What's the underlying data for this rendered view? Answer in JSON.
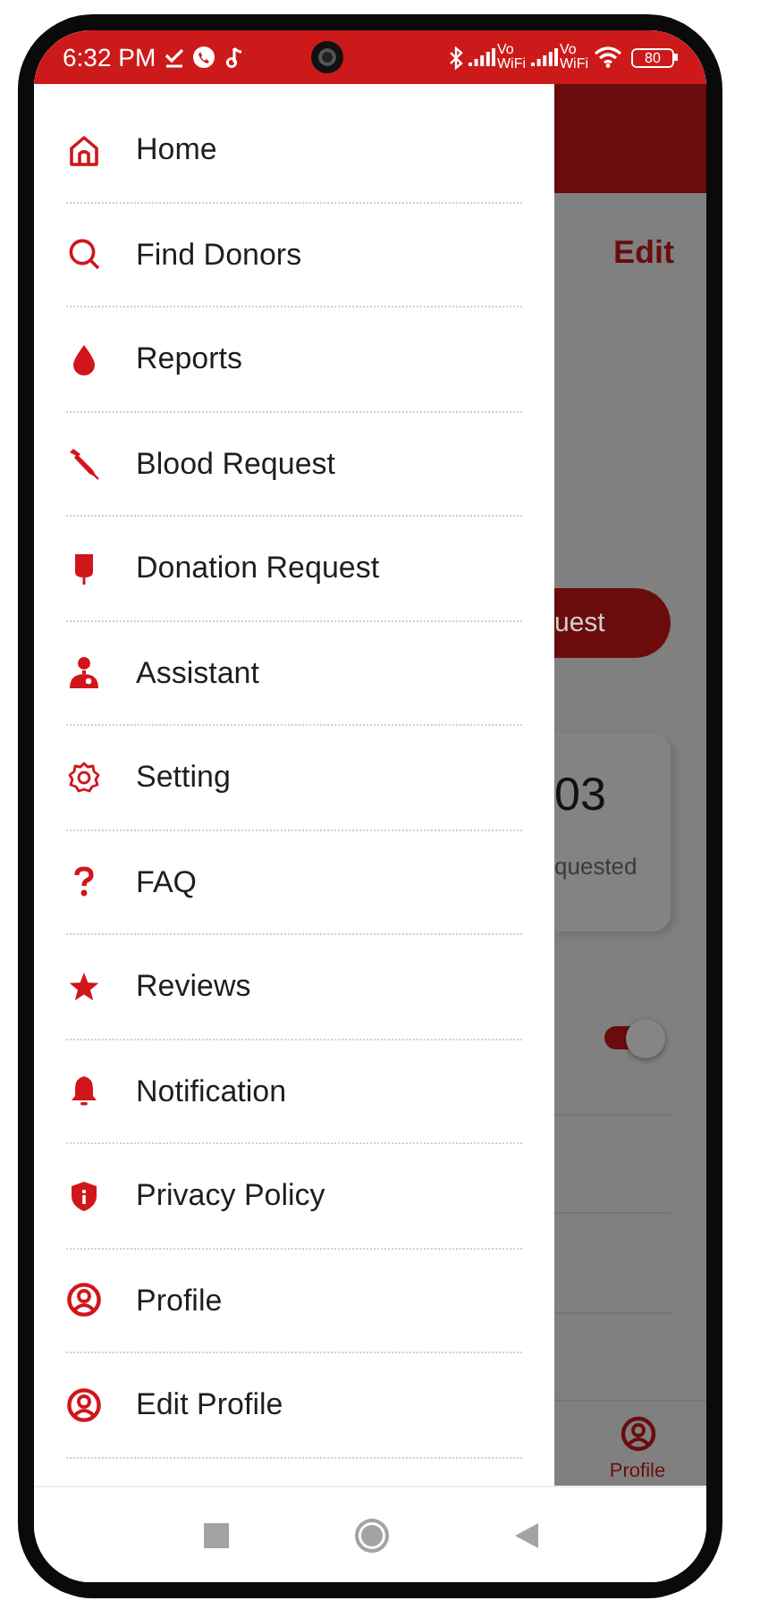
{
  "status_bar": {
    "time": "6:32 PM",
    "vowifi_labels": [
      {
        "top": "Vo",
        "bottom": "WiFi"
      },
      {
        "top": "Vo",
        "bottom": "WiFi"
      }
    ],
    "battery": "80"
  },
  "drawer": {
    "items": [
      {
        "label": "Home",
        "kind": "home"
      },
      {
        "label": "Find Donors",
        "kind": "search"
      },
      {
        "label": "Reports",
        "kind": "drop"
      },
      {
        "label": "Blood Request",
        "kind": "dropper"
      },
      {
        "label": "Donation Request",
        "kind": "bag"
      },
      {
        "label": "Assistant",
        "kind": "doctor"
      },
      {
        "label": "Setting",
        "kind": "gear"
      },
      {
        "label": "FAQ",
        "kind": "question"
      },
      {
        "label": "Reviews",
        "kind": "star"
      },
      {
        "label": "Notification",
        "kind": "bell"
      },
      {
        "label": "Privacy Policy",
        "kind": "shield"
      },
      {
        "label": "Profile",
        "kind": "user"
      },
      {
        "label": "Edit Profile",
        "kind": "user"
      }
    ]
  },
  "background": {
    "edit": "Edit",
    "button": "uest",
    "card_value": "03",
    "card_label": "quested",
    "toggle": {
      "on": true
    },
    "nav_item": "Profile"
  }
}
